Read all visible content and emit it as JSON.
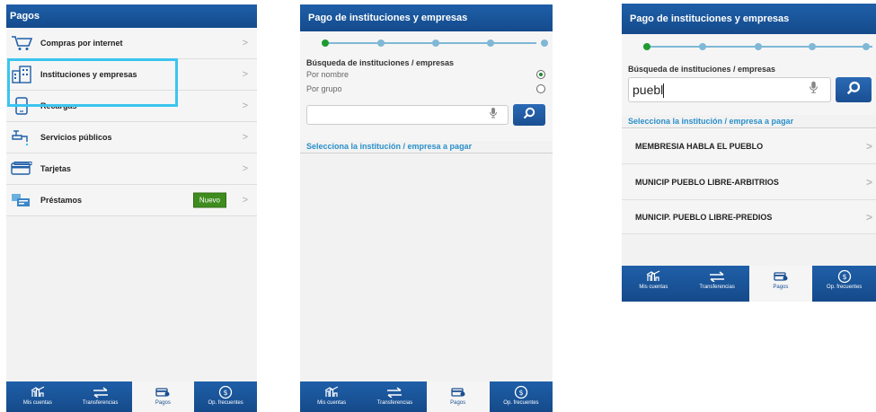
{
  "screen1": {
    "header_title": "Pagos",
    "menu": [
      {
        "label": "Compras por internet",
        "icon": "shopping-cart-icon"
      },
      {
        "label": "Instituciones y empresas",
        "icon": "building-icon"
      },
      {
        "label": "Recargas",
        "icon": "phone-icon"
      },
      {
        "label": "Servicios públicos",
        "icon": "faucet-icon"
      },
      {
        "label": "Tarjetas",
        "icon": "card-icon"
      },
      {
        "label": "Préstamos",
        "icon": "loan-icon",
        "badge": "Nuevo"
      }
    ],
    "chevron": ">"
  },
  "screen2": {
    "header_title": "Pago de instituciones y empresas",
    "search_title": "Búsqueda de instituciones / empresas",
    "option_by_name": "Por nombre",
    "option_by_group": "Por grupo",
    "selected_option": "Por nombre",
    "search_value": "",
    "select_prompt": "Selecciona la institución / empresa a pagar",
    "progress_step": 1,
    "progress_total": 5
  },
  "screen3": {
    "header_title": "Pago de instituciones y empresas",
    "search_title": "Búsqueda de instituciones / empresas",
    "search_value": "puebl",
    "select_prompt": "Selecciona la institución / empresa a pagar",
    "results": [
      "MEMBRESIA HABLA EL PUEBLO",
      "MUNICIP PUEBLO LIBRE-ARBITRIOS",
      "MUNICIP. PUEBLO LIBRE-PREDIOS"
    ],
    "progress_step": 1,
    "progress_total": 5,
    "chevron": ">"
  },
  "bottom_nav": [
    {
      "label": "Mis cuentas",
      "icon": "accounts-chart-icon"
    },
    {
      "label": "Transferencias",
      "icon": "transfer-arrows-icon"
    },
    {
      "label": "Pagos",
      "icon": "payment-card-icon",
      "active": true
    },
    {
      "label": "Op. frecuentes",
      "icon": "frequent-ops-icon"
    }
  ],
  "colors": {
    "header_blue": "#1f5fa8",
    "accent_green": "#3e8c1e",
    "highlight_cyan": "#3bc4f0",
    "link_blue": "#2a8fc9",
    "step_active": "#1e9b2e",
    "step_inactive": "#7fb8d6"
  }
}
